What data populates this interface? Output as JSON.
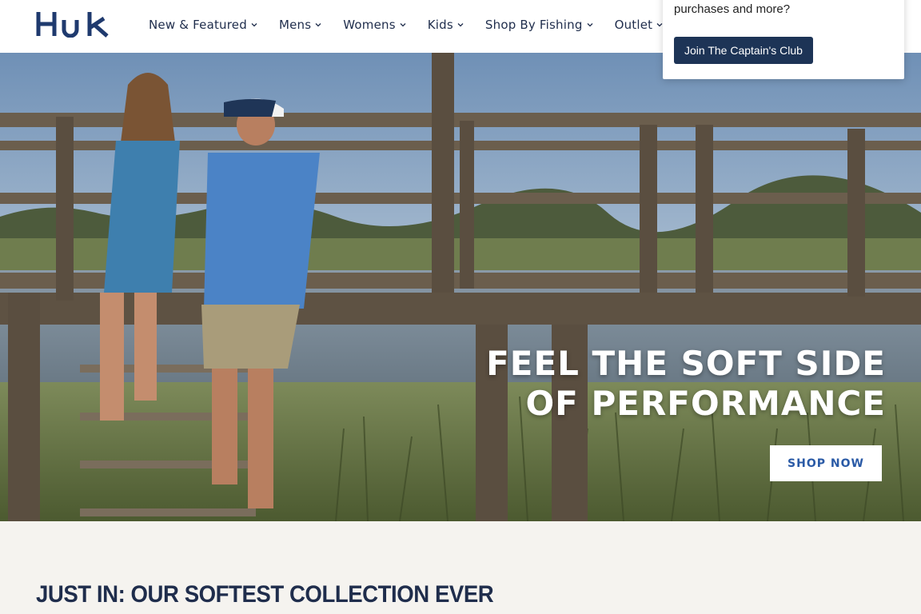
{
  "brand": {
    "name": "Huk",
    "logo_text": "Huk",
    "color": "#1f3a6e"
  },
  "nav": {
    "items": [
      {
        "label": "New & Featured"
      },
      {
        "label": "Mens"
      },
      {
        "label": "Womens"
      },
      {
        "label": "Kids"
      },
      {
        "label": "Shop By Fishing"
      },
      {
        "label": "Outlet"
      }
    ]
  },
  "popup": {
    "text": "purchases and more?",
    "button_label": "Join The Captain's Club"
  },
  "hero": {
    "title_line1": "FEEL THE SOFT SIDE",
    "title_line2": "OF PERFORMANCE",
    "cta_label": "SHOP NOW"
  },
  "section": {
    "title": "JUST IN: OUR SOFTEST COLLECTION EVER"
  },
  "colors": {
    "navy": "#1f2d4c",
    "button_navy": "#1d3456",
    "cta_blue": "#2a5aa6",
    "section_bg": "#f5f3ef"
  }
}
